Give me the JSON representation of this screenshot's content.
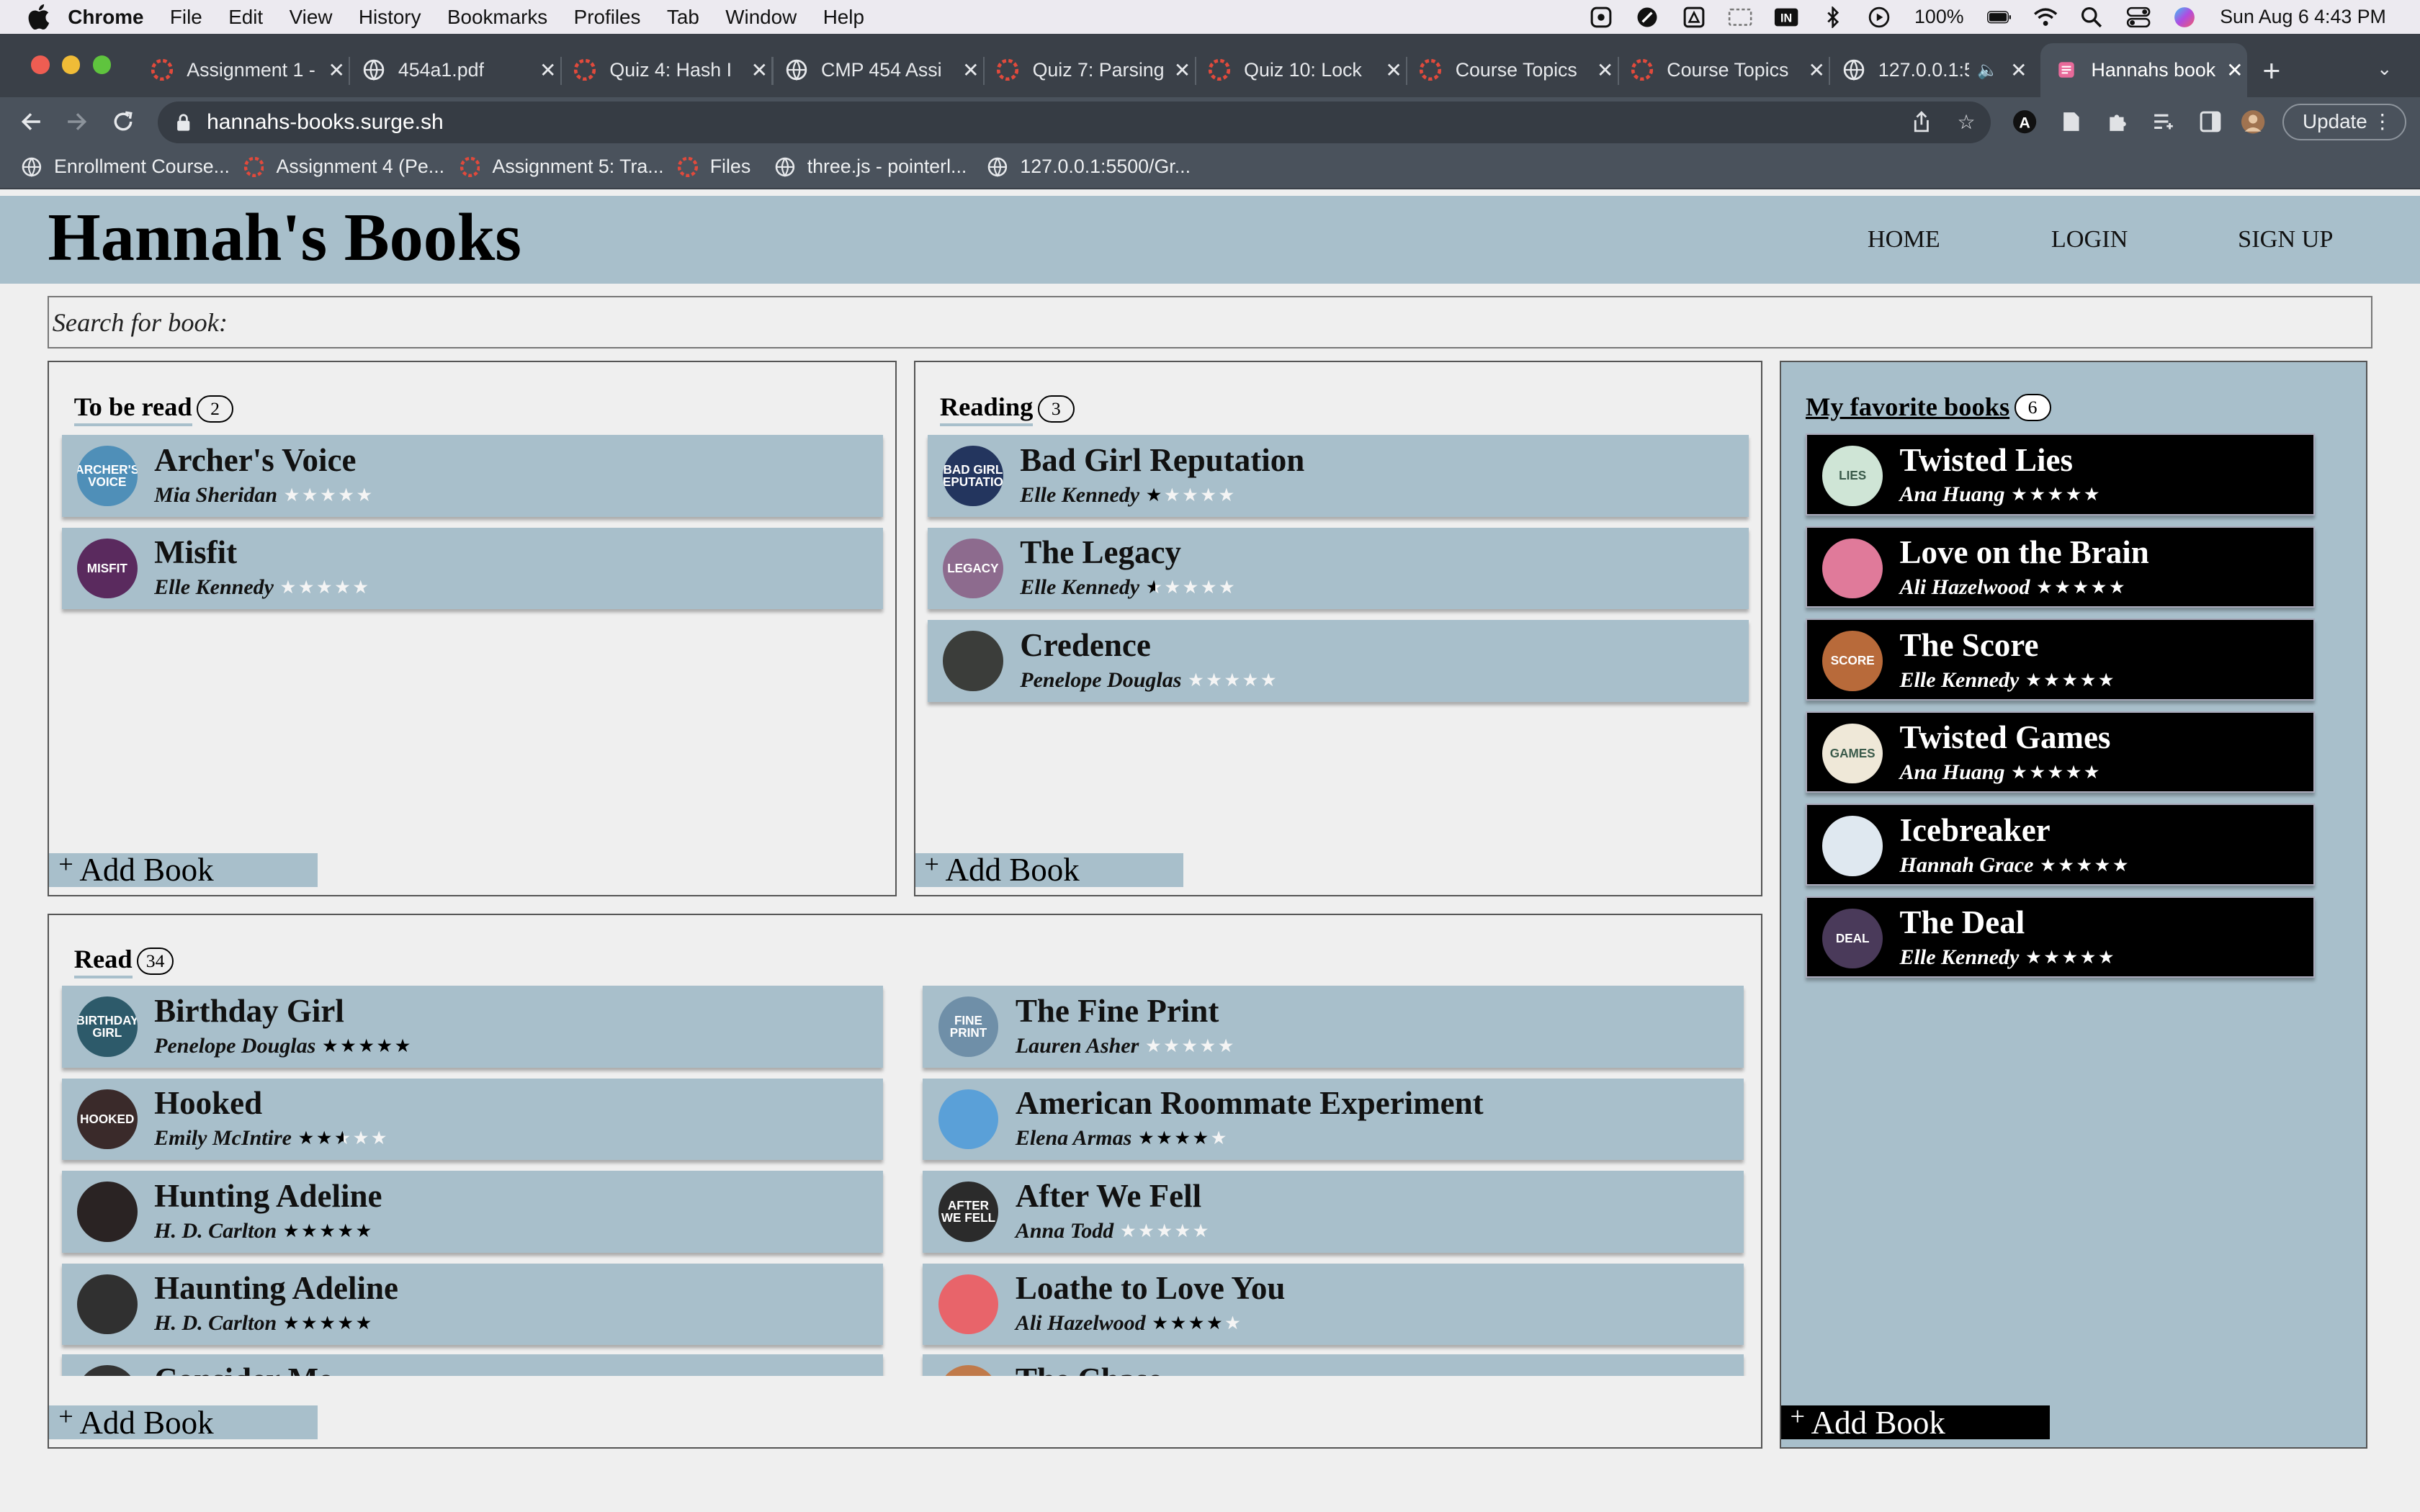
{
  "menubar": {
    "app": "Chrome",
    "items": [
      "File",
      "Edit",
      "View",
      "History",
      "Bookmarks",
      "Profiles",
      "Tab",
      "Window",
      "Help"
    ],
    "battery": "100%",
    "datetime": "Sun Aug 6  4:43 PM"
  },
  "tabs": [
    {
      "title": "Assignment 1 -",
      "icon": "canvas-icon"
    },
    {
      "title": "454a1.pdf",
      "icon": "globe-icon"
    },
    {
      "title": "Quiz 4: Hash I",
      "icon": "canvas-icon"
    },
    {
      "title": "CMP 454 Assi",
      "icon": "globe-icon"
    },
    {
      "title": "Quiz 7: Parsing",
      "icon": "canvas-icon"
    },
    {
      "title": "Quiz 10: Lock",
      "icon": "canvas-icon"
    },
    {
      "title": "Course Topics",
      "icon": "canvas-icon"
    },
    {
      "title": "Course Topics",
      "icon": "canvas-icon"
    },
    {
      "title": "127.0.0.1:5",
      "icon": "globe-icon"
    },
    {
      "title": "Hannahs book",
      "icon": "site-icon",
      "active": true
    }
  ],
  "omnibox": {
    "url": "hannahs-books.surge.sh",
    "update_label": "Update"
  },
  "bookmarks": [
    "Enrollment Course...",
    "Assignment 4 (Pe...",
    "Assignment 5: Tra...",
    "Files",
    "three.js - pointerl...",
    "127.0.0.1:5500/Gr..."
  ],
  "site": {
    "title": "Hannah's Books",
    "nav": [
      "HOME",
      "LOGIN",
      "SIGN UP"
    ],
    "search_placeholder": "Search for book:"
  },
  "lists": {
    "to_read": {
      "title": "To be read",
      "count": "2",
      "add_label": "Add Book",
      "books": [
        {
          "title": "Archer's Voice",
          "author": "Mia Sheridan",
          "rating": 0,
          "cover_text": "ARCHER'S VOICE",
          "cover_color": "#4f8fb8"
        },
        {
          "title": "Misfit",
          "author": "Elle Kennedy",
          "rating": 0,
          "cover_text": "MISFIT",
          "cover_color": "#5a2a5e"
        }
      ]
    },
    "reading": {
      "title": "Reading",
      "count": "3",
      "add_label": "Add Book",
      "books": [
        {
          "title": "Bad Girl Reputation",
          "author": "Elle Kennedy",
          "rating": 1,
          "cover_text": "BAD GIRL REPUTATION",
          "cover_color": "#23355e"
        },
        {
          "title": "The Legacy",
          "author": "Elle Kennedy",
          "rating": 0.5,
          "cover_text": "LEGACY",
          "cover_color": "#8d6b8e"
        },
        {
          "title": "Credence",
          "author": "Penelope Douglas",
          "rating": 0,
          "cover_text": "",
          "cover_color": "#3b3d3a"
        }
      ]
    },
    "read": {
      "title": "Read",
      "count": "34",
      "add_label": "Add Book",
      "books": [
        {
          "title": "Birthday Girl",
          "author": "Penelope Douglas",
          "rating": 5,
          "cover_text": "BIRTHDAY GIRL",
          "cover_color": "#2d5a6a"
        },
        {
          "title": "The Fine Print",
          "author": "Lauren Asher",
          "rating": 0,
          "cover_text": "FINE PRINT",
          "cover_color": "#6f8fa8"
        },
        {
          "title": "Hooked",
          "author": "Emily McIntire",
          "rating": 2.5,
          "cover_text": "HOOKED",
          "cover_color": "#3a2a2a"
        },
        {
          "title": "American Roommate Experiment",
          "author": "Elena Armas",
          "rating": 4,
          "cover_text": "",
          "cover_color": "#5aa0d8"
        },
        {
          "title": "Hunting Adeline",
          "author": "H. D. Carlton",
          "rating": 5,
          "cover_text": "",
          "cover_color": "#2a2323"
        },
        {
          "title": "After We Fell",
          "author": "Anna Todd",
          "rating": 0,
          "cover_text": "AFTER WE FELL",
          "cover_color": "#2b2b2b"
        },
        {
          "title": "Haunting Adeline",
          "author": "H. D. Carlton",
          "rating": 5,
          "cover_text": "",
          "cover_color": "#303030"
        },
        {
          "title": "Loathe to Love You",
          "author": "Ali Hazelwood",
          "rating": 4,
          "cover_text": "",
          "cover_color": "#e8646a"
        }
      ]
    },
    "favorites": {
      "title": "My favorite books",
      "count": "6",
      "add_label": "Add Book",
      "books": [
        {
          "title": "Twisted Lies",
          "author": "Ana Huang",
          "rating": 5,
          "cover_text": "LIES",
          "cover_color": "#cfe5d6"
        },
        {
          "title": "Love on the Brain",
          "author": "Ali Hazelwood",
          "rating": 5,
          "cover_text": "",
          "cover_color": "#e07a9a"
        },
        {
          "title": "The Score",
          "author": "Elle Kennedy",
          "rating": 5,
          "cover_text": "SCORE",
          "cover_color": "#b86a3a"
        },
        {
          "title": "Twisted Games",
          "author": "Ana Huang",
          "rating": 5,
          "cover_text": "GAMES",
          "cover_color": "#efe8d8"
        },
        {
          "title": "Icebreaker",
          "author": "Hannah Grace",
          "rating": 5,
          "cover_text": "",
          "cover_color": "#dfe8f0"
        },
        {
          "title": "The Deal",
          "author": "Elle Kennedy",
          "rating": 5,
          "cover_text": "DEAL",
          "cover_color": "#4a3a5a"
        }
      ]
    }
  },
  "colors": {
    "accent": "#a8bfcb",
    "page_bg": "#efefef",
    "chrome_dark": "#3a4048",
    "chrome_toolbar": "#4a525c"
  }
}
